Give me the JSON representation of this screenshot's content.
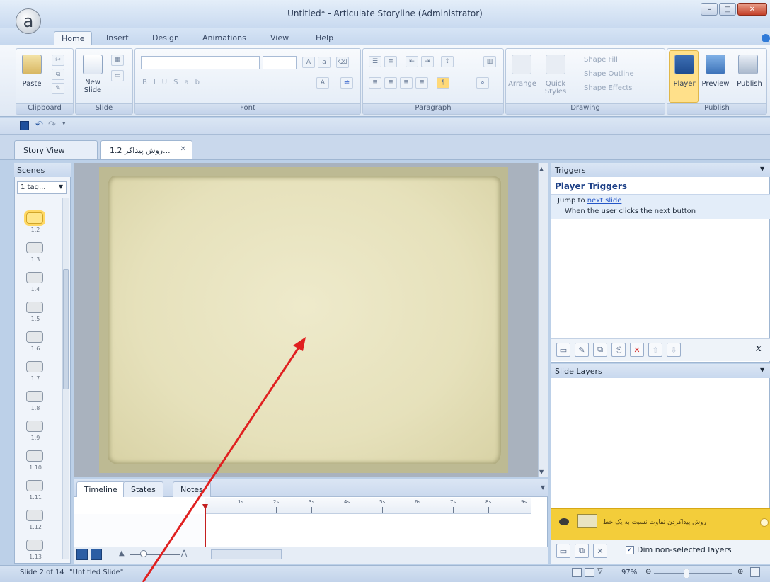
{
  "window": {
    "title": "Untitled* - Articulate Storyline (Administrator)",
    "logo_glyph": "a",
    "min": "–",
    "max": "□",
    "close": "✕"
  },
  "ribbon_tabs": [
    "Home",
    "Insert",
    "Design",
    "Animations",
    "View",
    "Help"
  ],
  "active_tab": "Home",
  "ribbon": {
    "clipboard": {
      "label": "Clipboard",
      "paste": "Paste"
    },
    "slide": {
      "label": "Slide",
      "new_slide": "New Slide"
    },
    "font": {
      "label": "Font",
      "size_field": ""
    },
    "paragraph": {
      "label": "Paragraph"
    },
    "drawing": {
      "label": "Drawing",
      "arrange": "Arrange",
      "quick_styles": "Quick Styles",
      "shape_fill": "Shape Fill",
      "shape_outline": "Shape Outline",
      "shape_effects": "Shape Effects"
    },
    "publish": {
      "label": "Publish",
      "player": "Player",
      "preview": "Preview",
      "publish": "Publish"
    }
  },
  "doc_tabs": [
    {
      "label": "Story View",
      "active": false
    },
    {
      "label": "1.2 روش پیداکر...",
      "active": true
    }
  ],
  "scenes": {
    "header": "Scenes",
    "selected": "1 tag...",
    "thumb_labels": [
      "1.2",
      "1.3",
      "1.4",
      "1.5",
      "1.6",
      "1.7",
      "1.8",
      "1.9",
      "1.10",
      "1.11",
      "1.12",
      "1.13"
    ]
  },
  "timeline": {
    "tabs": [
      "Timeline",
      "States",
      "Notes"
    ],
    "ruler_labels": [
      "1s",
      "2s",
      "3s",
      "4s",
      "5s",
      "6s",
      "7s",
      "8s",
      "9s"
    ]
  },
  "triggers": {
    "header": "Triggers",
    "group": "Player Triggers",
    "action_prefix": "Jump to",
    "action_link": "next slide",
    "condition": "When the user clicks the next button",
    "var_icon": "x"
  },
  "layers": {
    "header": "Slide Layers",
    "base_layer_name": "روش پیداکردن تفاوت نسبت به یک خط",
    "dim_label": "Dim non-selected layers",
    "dim_checked": true
  },
  "status": {
    "slide": "Slide 2 of 14",
    "title": "\"Untitled Slide\"",
    "zoom": "97%"
  },
  "colors": {
    "accent_blue": "#2f5fa5",
    "layer_yellow": "#f3cd3a",
    "arrow_red": "#e02020"
  }
}
